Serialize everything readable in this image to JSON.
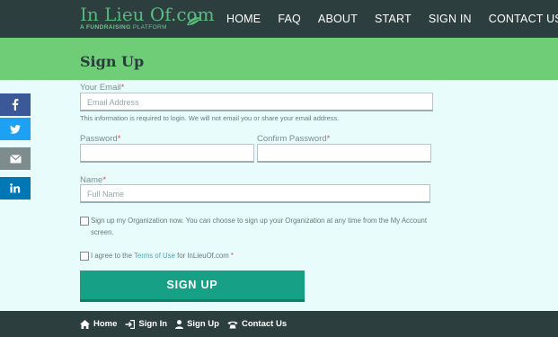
{
  "header": {
    "logo_main_a": "In Lieu ",
    "logo_main_b": "Of.com",
    "logo_sub_bold": "A FUNDRAISING",
    "logo_sub_light": "PLATFORM",
    "nav": [
      "HOME",
      "FAQ",
      "ABOUT",
      "START",
      "SIGN IN",
      "CONTACT US"
    ]
  },
  "page": {
    "title": "Sign Up"
  },
  "form": {
    "email_label": "Your Email",
    "email_placeholder": "Email Address",
    "email_note": "This information is required to login. We will not email you or share your email address.",
    "password_label": "Password",
    "confirm_label": "Confirm Password",
    "name_label": "Name",
    "name_placeholder": "Full Name",
    "required_mark": "*",
    "org_checkbox_text": "Sign up my Organization now. You can choose to sign up your Organization at any time from the My Account screen.",
    "terms_prefix": "I agree to the ",
    "terms_link": "Terms of Use",
    "terms_suffix": " for InLieuOf.com ",
    "submit_label": "SIGN UP"
  },
  "share": {
    "icons": [
      "facebook-icon",
      "twitter-icon",
      "email-icon",
      "linkedin-icon"
    ],
    "colors": [
      "#3b5998",
      "#1da1f2",
      "#7f8c8d",
      "#0077b5"
    ]
  },
  "footer": {
    "links": [
      "Home",
      "Sign In",
      "Sign Up",
      "Contact Us"
    ]
  },
  "colors": {
    "header_bg": "#2d3e3f",
    "title_band": "#6fcd78",
    "form_bg": "#e7fcfb",
    "button": "#16a085",
    "brand_green": "#54b97a"
  }
}
